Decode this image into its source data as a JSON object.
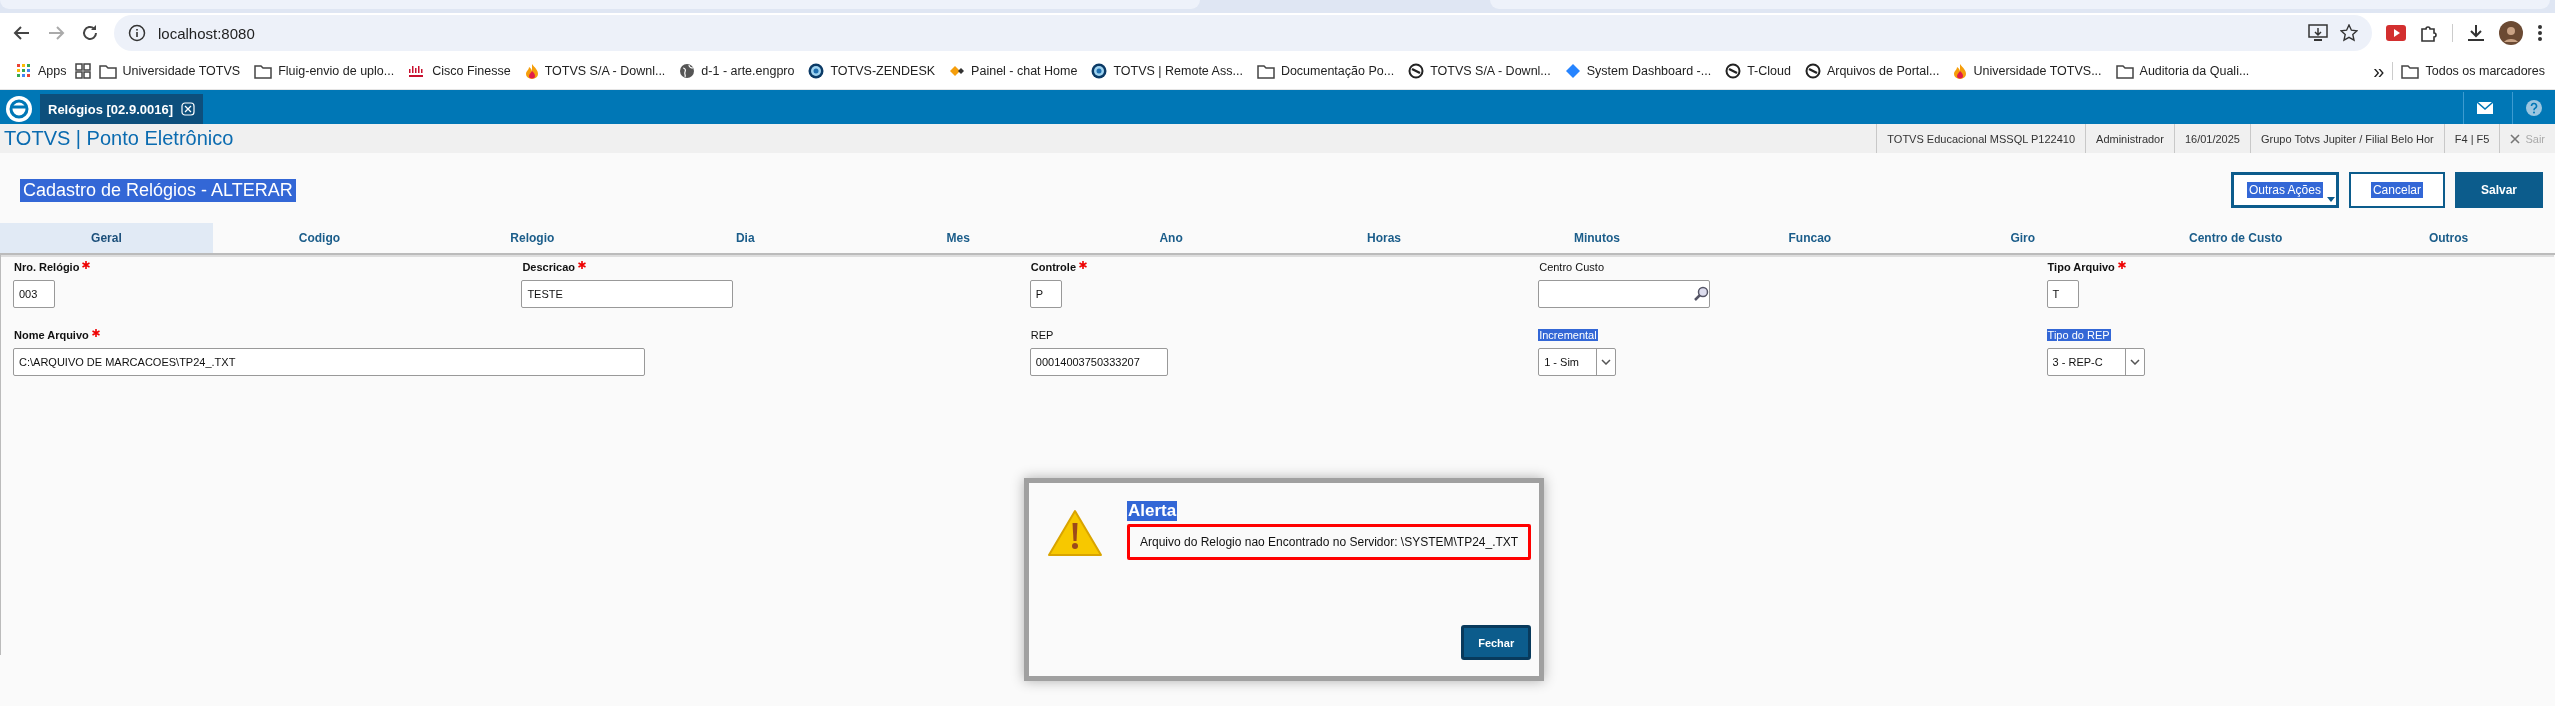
{
  "browser": {
    "address": "localhost:8080",
    "bookmarks": [
      {
        "label": "Apps",
        "kind": "apps"
      },
      {
        "kind": "grid"
      },
      {
        "label": "Universidade TOTVS",
        "kind": "folder"
      },
      {
        "label": "Fluig-envio de uplo...",
        "kind": "folder"
      },
      {
        "label": "Cisco Finesse",
        "kind": "cisco"
      },
      {
        "label": "TOTVS S/A - Downl...",
        "kind": "flame"
      },
      {
        "label": "d-1 - arte.engpro",
        "kind": "globe"
      },
      {
        "label": "TOTVS-ZENDESK",
        "kind": "orb"
      },
      {
        "label": "Painel - chat Home",
        "kind": "duo"
      },
      {
        "label": "TOTVS | Remote Ass...",
        "kind": "orb"
      },
      {
        "label": "Documentação Po...",
        "kind": "folder"
      },
      {
        "label": "TOTVS S/A - Downl...",
        "kind": "ring"
      },
      {
        "label": "System Dashboard -...",
        "kind": "diamond"
      },
      {
        "label": "T-Cloud",
        "kind": "ring"
      },
      {
        "label": "Arquivos de Portal...",
        "kind": "ring"
      },
      {
        "label": "Universidade TOTVS...",
        "kind": "flame"
      },
      {
        "label": "Auditoria da Quali...",
        "kind": "folder"
      }
    ],
    "overflow": "»",
    "all_bookmarks": "Todos os marcadores"
  },
  "app": {
    "tabs": [
      {
        "label": "Relógios [02.9.0016]",
        "selected": true
      }
    ],
    "title": "TOTVS | Ponto Eletrônico",
    "info": [
      "TOTVS Educacional MSSQL P122410",
      "Administrador",
      "16/01/2025",
      "Grupo Totvs Jupiter / Filial Belo Hor",
      "F4 | F5"
    ],
    "logout": {
      "label": "Sair",
      "disabled": true
    }
  },
  "form": {
    "title": "Cadastro de Relógios - ALTERAR",
    "title_highlighted": true,
    "buttons": [
      {
        "label": "Outras Ações",
        "kind": "menu",
        "highlighted": true
      },
      {
        "label": "Cancelar",
        "kind": "outline",
        "highlighted": true
      },
      {
        "label": "Salvar",
        "kind": "primary",
        "highlighted": false
      }
    ],
    "tabs": [
      {
        "label": "Geral",
        "selected": true
      },
      {
        "label": "Codigo",
        "selected": false
      },
      {
        "label": "Relogio",
        "selected": false
      },
      {
        "label": "Dia",
        "selected": false
      },
      {
        "label": "Mes",
        "selected": false
      },
      {
        "label": "Ano",
        "selected": false
      },
      {
        "label": "Horas",
        "selected": false
      },
      {
        "label": "Minutos",
        "selected": false
      },
      {
        "label": "Funcao",
        "selected": false
      },
      {
        "label": "Giro",
        "selected": false
      },
      {
        "label": "Centro de Custo",
        "selected": false
      },
      {
        "label": "Outros",
        "selected": false
      }
    ],
    "rows": [
      [
        {
          "label": "Nro. Relógio",
          "required": true,
          "highlighted": false,
          "kind": "text",
          "value": "003"
        },
        {
          "label": "Descricao",
          "required": true,
          "highlighted": false,
          "kind": "text",
          "value": "TESTE"
        },
        {
          "label": "Controle",
          "required": true,
          "highlighted": false,
          "kind": "text",
          "value": "P"
        },
        {
          "label": "Centro Custo",
          "required": false,
          "highlighted": false,
          "kind": "lookup"
        },
        {
          "label": "Tipo Arquivo",
          "required": true,
          "highlighted": false,
          "kind": "text",
          "value": "T"
        }
      ],
      [
        {
          "label": "Nome Arquivo",
          "required": true,
          "highlighted": false,
          "kind": "text",
          "value": "C:\\ARQUIVO DE MARCACOES\\TP24_.TXT"
        },
        "",
        {
          "label": "REP",
          "required": false,
          "highlighted": false,
          "kind": "text",
          "value": "00014003750333207"
        },
        {
          "label": "Incremental",
          "required": false,
          "highlighted": true,
          "kind": "select",
          "value": "1 - Sim"
        },
        {
          "label": "Tipo do REP",
          "required": false,
          "highlighted": true,
          "kind": "select",
          "value": "3 - REP-C"
        }
      ]
    ]
  },
  "dialog": {
    "title": "Alerta",
    "title_highlighted": true,
    "message": "Arquivo do Relogio nao Encontrado no Servidor: \\SYSTEM\\TP24_.TXT",
    "button": "Fechar"
  }
}
